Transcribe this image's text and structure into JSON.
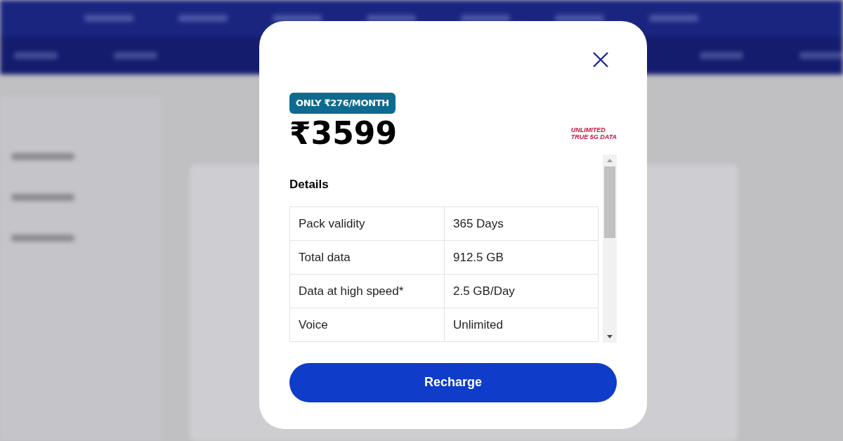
{
  "modal": {
    "badge": "ONLY ₹276/MONTH",
    "price": "₹3599",
    "tagline_lines": [
      "UNLIMITED",
      "TRUE 5G DATA"
    ],
    "section_title": "Details",
    "details": [
      {
        "label": "Pack validity",
        "value": "365 Days"
      },
      {
        "label": "Total data",
        "value": "912.5 GB"
      },
      {
        "label": "Data at high speed*",
        "value": "2.5 GB/Day"
      },
      {
        "label": "Voice",
        "value": "Unlimited"
      }
    ],
    "button": "Recharge"
  }
}
